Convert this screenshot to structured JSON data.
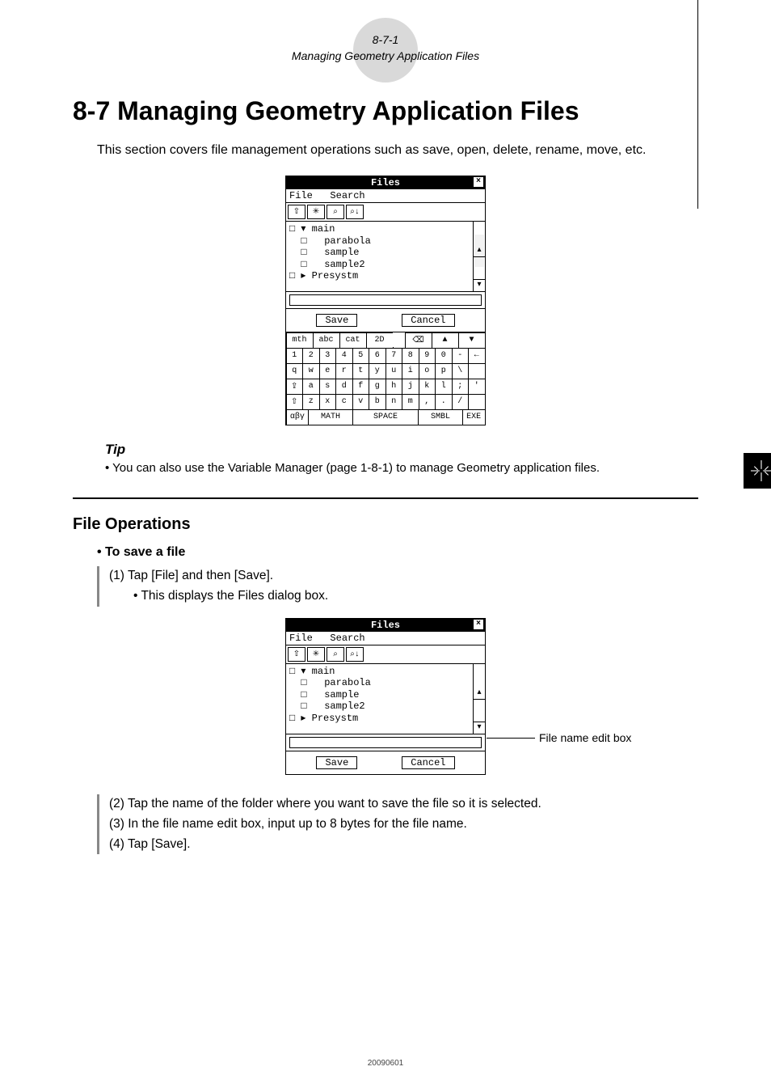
{
  "header": {
    "page_ref": "8-7-1",
    "section_title": "Managing Geometry Application Files"
  },
  "title": "8-7 Managing Geometry Application Files",
  "intro": "This section covers file management operations such as save, open, delete, rename, move, etc.",
  "dialog": {
    "title": "Files",
    "menu": {
      "file": "File",
      "search": "Search"
    },
    "toolbar_icons": [
      "up-folder-icon",
      "new-folder-icon",
      "binoculars-icon",
      "binoculars-down-icon"
    ],
    "tree_text": "□ ▾ main\n  □   parabola\n  □   sample\n  □   sample2\n□ ▸ Presystm",
    "save": "Save",
    "cancel": "Cancel"
  },
  "keyboard": {
    "tabs": [
      "mth",
      "abc",
      "cat",
      "2D"
    ],
    "tab_icons": [
      "⌫",
      "▲",
      "▼"
    ],
    "row_nums": [
      "1",
      "2",
      "3",
      "4",
      "5",
      "6",
      "7",
      "8",
      "9",
      "0",
      "-",
      "←"
    ],
    "row_q": [
      "q",
      "w",
      "e",
      "r",
      "t",
      "y",
      "u",
      "i",
      "o",
      "p",
      "\\",
      " "
    ],
    "row_a": [
      "⇪",
      "a",
      "s",
      "d",
      "f",
      "g",
      "h",
      "j",
      "k",
      "l",
      ";",
      "'"
    ],
    "row_z": [
      "⇧",
      "z",
      "x",
      "c",
      "v",
      "b",
      "n",
      "m",
      ",",
      ".",
      "/",
      " "
    ],
    "row_bot": [
      "αβγ",
      "MATH",
      "SPACE",
      "SMBL",
      "EXE"
    ]
  },
  "tip": {
    "heading": "Tip",
    "bullet": "• You can also use the Variable Manager (page 1-8-1) to manage Geometry application files."
  },
  "file_ops": {
    "heading": "File Operations",
    "sub": "• To save a file",
    "step1": "(1) Tap [File] and then [Save].",
    "step1a": "• This displays the Files dialog box.",
    "callout": "File name edit box",
    "step2": "(2) Tap the name of the folder where you want to save the file so it is selected.",
    "step3": "(3) In the file name edit box, input up to 8 bytes for the file name.",
    "step4": "(4) Tap [Save]."
  },
  "footer_code": "20090601"
}
